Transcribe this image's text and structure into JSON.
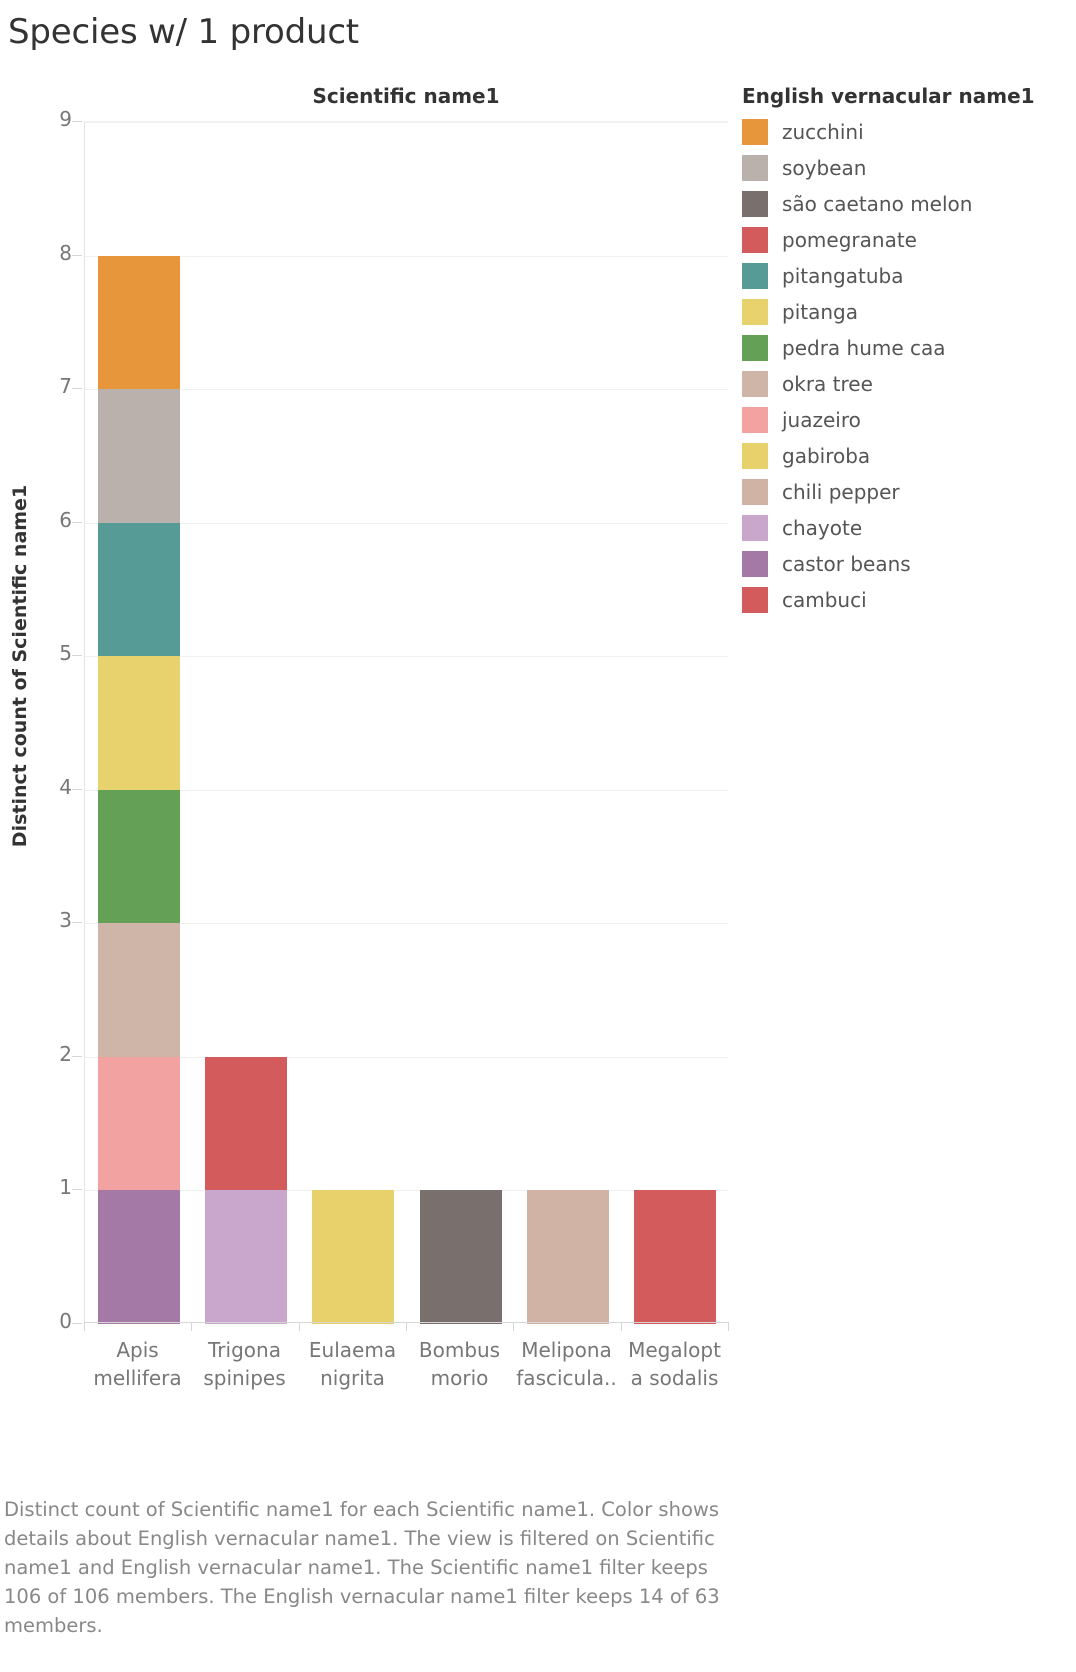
{
  "dashboard": {
    "title": "Species w/ 1 product"
  },
  "chart_data": {
    "type": "bar",
    "title": "Scientific name1",
    "subtitle": "",
    "stacked": true,
    "xlabel": "",
    "ylabel": "Distinct count of Scientific name1",
    "ylim": [
      0,
      9
    ],
    "yticks": [
      0,
      1,
      2,
      3,
      4,
      5,
      6,
      7,
      8,
      9
    ],
    "ytick_labels": [
      "0",
      "1",
      "2",
      "3",
      "4",
      "5",
      "6",
      "7",
      "8",
      "9"
    ],
    "grid": true,
    "legend_position": "right",
    "legend_title": "English vernacular name1",
    "categories": [
      "Apis mellifera",
      "Trigona spinipes",
      "Eulaema nigrita",
      "Bombus morio",
      "Melipona fascicula..",
      "Megalopt a sodalis"
    ],
    "category_label_lines": [
      [
        "Apis",
        "mellifera"
      ],
      [
        "Trigona",
        "spinipes"
      ],
      [
        "Eulaema",
        "nigrita"
      ],
      [
        "Bombus",
        "morio"
      ],
      [
        "Melipona",
        "fascicula.."
      ],
      [
        "Megalopt",
        "a sodalis"
      ]
    ],
    "totals": [
      8,
      2,
      1,
      1,
      1,
      1
    ],
    "series": [
      {
        "name": "zucchini",
        "color": "#e8963c",
        "values": [
          1,
          0,
          0,
          0,
          0,
          0
        ]
      },
      {
        "name": "soybean",
        "color": "#bab0ac",
        "values": [
          1,
          0,
          0,
          0,
          0,
          0
        ]
      },
      {
        "name": "são caetano melon",
        "color": "#79706e",
        "values": [
          0,
          0,
          0,
          1,
          0,
          0
        ]
      },
      {
        "name": "pomegranate",
        "color": "#d45b5b",
        "values": [
          0,
          1,
          0,
          0,
          0,
          0
        ]
      },
      {
        "name": "pitangatuba",
        "color": "#569b95",
        "values": [
          1,
          0,
          0,
          0,
          0,
          0
        ]
      },
      {
        "name": "pitanga",
        "color": "#e8d26e",
        "values": [
          1,
          0,
          0,
          0,
          0,
          0
        ]
      },
      {
        "name": "pedra hume caa",
        "color": "#65a057",
        "values": [
          1,
          0,
          0,
          0,
          0,
          0
        ]
      },
      {
        "name": "okra tree",
        "color": "#cfb4a8",
        "values": [
          1,
          0,
          0,
          0,
          0,
          0
        ]
      },
      {
        "name": "juazeiro",
        "color": "#f2a2a0",
        "values": [
          1,
          0,
          0,
          0,
          0,
          0
        ]
      },
      {
        "name": "gabiroba",
        "color": "#e8d06a",
        "values": [
          0,
          0,
          1,
          0,
          0,
          0
        ]
      },
      {
        "name": "chili pepper",
        "color": "#d0b3a4",
        "values": [
          0,
          0,
          0,
          0,
          1,
          0
        ]
      },
      {
        "name": "chayote",
        "color": "#c9a6cc",
        "values": [
          0,
          1,
          0,
          0,
          0,
          0
        ]
      },
      {
        "name": "castor beans",
        "color": "#a579a5",
        "values": [
          1,
          0,
          0,
          0,
          0,
          0
        ]
      },
      {
        "name": "cambuci",
        "color": "#d45b5b",
        "values": [
          0,
          0,
          0,
          0,
          0,
          1
        ]
      }
    ],
    "stack_order_by_category": [
      [
        {
          "name": "castor beans",
          "color": "#a579a5",
          "from": 0,
          "to": 1
        },
        {
          "name": "juazeiro",
          "color": "#f2a2a0",
          "from": 1,
          "to": 2
        },
        {
          "name": "okra tree",
          "color": "#cfb4a8",
          "from": 2,
          "to": 3
        },
        {
          "name": "pedra hume caa",
          "color": "#65a057",
          "from": 3,
          "to": 4
        },
        {
          "name": "pitanga",
          "color": "#e8d26e",
          "from": 4,
          "to": 5
        },
        {
          "name": "pitangatuba",
          "color": "#569b95",
          "from": 5,
          "to": 6
        },
        {
          "name": "soybean",
          "color": "#bab0ac",
          "from": 6,
          "to": 7
        },
        {
          "name": "zucchini",
          "color": "#e8963c",
          "from": 7,
          "to": 8
        }
      ],
      [
        {
          "name": "chayote",
          "color": "#c9a6cc",
          "from": 0,
          "to": 1
        },
        {
          "name": "pomegranate",
          "color": "#d45b5b",
          "from": 1,
          "to": 2
        }
      ],
      [
        {
          "name": "gabiroba",
          "color": "#e8d06a",
          "from": 0,
          "to": 1
        }
      ],
      [
        {
          "name": "são caetano melon",
          "color": "#79706e",
          "from": 0,
          "to": 1
        }
      ],
      [
        {
          "name": "chili pepper",
          "color": "#d0b3a4",
          "from": 0,
          "to": 1
        }
      ],
      [
        {
          "name": "cambuci",
          "color": "#d45b5b",
          "from": 0,
          "to": 1
        }
      ]
    ]
  },
  "legend": {
    "title": "English vernacular name1",
    "items": [
      {
        "label": "zucchini",
        "color": "#e8963c"
      },
      {
        "label": "soybean",
        "color": "#bab0ac"
      },
      {
        "label": "são caetano melon",
        "color": "#79706e"
      },
      {
        "label": "pomegranate",
        "color": "#d45b5b"
      },
      {
        "label": "pitangatuba",
        "color": "#569b95"
      },
      {
        "label": "pitanga",
        "color": "#e8d26e"
      },
      {
        "label": "pedra hume caa",
        "color": "#65a057"
      },
      {
        "label": "okra tree",
        "color": "#cfb4a8"
      },
      {
        "label": "juazeiro",
        "color": "#f2a2a0"
      },
      {
        "label": "gabiroba",
        "color": "#e8d06a"
      },
      {
        "label": "chili pepper",
        "color": "#d0b3a4"
      },
      {
        "label": "chayote",
        "color": "#c9a6cc"
      },
      {
        "label": "castor beans",
        "color": "#a579a5"
      },
      {
        "label": "cambuci",
        "color": "#d45b5b"
      }
    ]
  },
  "caption": {
    "text": "Distinct count of Scientific name1 for each Scientific name1.  Color shows details about English vernacular name1. The view is filtered on Scientific name1 and English vernacular name1. The Scientific name1 filter keeps 106 of 106 members. The English vernacular name1 filter keeps 14 of 63 members."
  }
}
